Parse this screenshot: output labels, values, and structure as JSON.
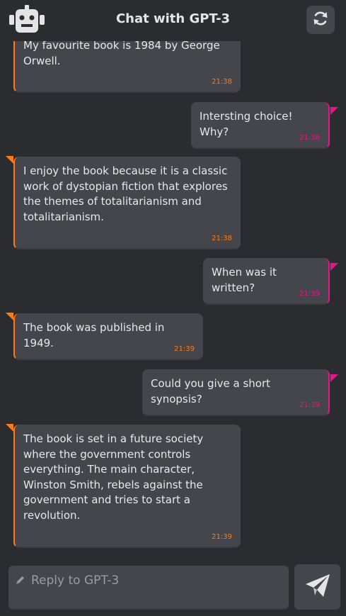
{
  "header": {
    "title": "Chat with GPT-3",
    "icons": {
      "bot": "robot-icon",
      "refresh": "refresh-icon"
    }
  },
  "colors": {
    "background": "#2a2c30",
    "bubble": "#44464c",
    "bot_accent": "#ff7a12",
    "user_accent": "#e8158a",
    "text": "#e8e8e8"
  },
  "messages": [
    {
      "sender": "bot",
      "text": "My favourite book is 1984 by George Orwell.",
      "time": "21:38"
    },
    {
      "sender": "user",
      "text": "Intersting choice! Why?",
      "time": "21:38"
    },
    {
      "sender": "bot",
      "text": "I enjoy the book because it is a classic work of dystopian fiction that explores the themes of totalitarianism and totalitarianism.",
      "time": "21:38"
    },
    {
      "sender": "user",
      "text": "When was it written?",
      "time": "21:39"
    },
    {
      "sender": "bot",
      "text": "The book was published in 1949.",
      "time": "21:39"
    },
    {
      "sender": "user",
      "text": "Could you give a short synopsis?",
      "time": "21:39"
    },
    {
      "sender": "bot",
      "text": "The book is set in a future society where the government controls everything. The main character, Winston Smith, rebels against the government and tries to start a revolution.",
      "time": "21:39"
    }
  ],
  "composer": {
    "placeholder": "Reply to GPT-3",
    "value": "",
    "icons": {
      "edit": "pencil-icon",
      "send": "send-icon"
    }
  }
}
